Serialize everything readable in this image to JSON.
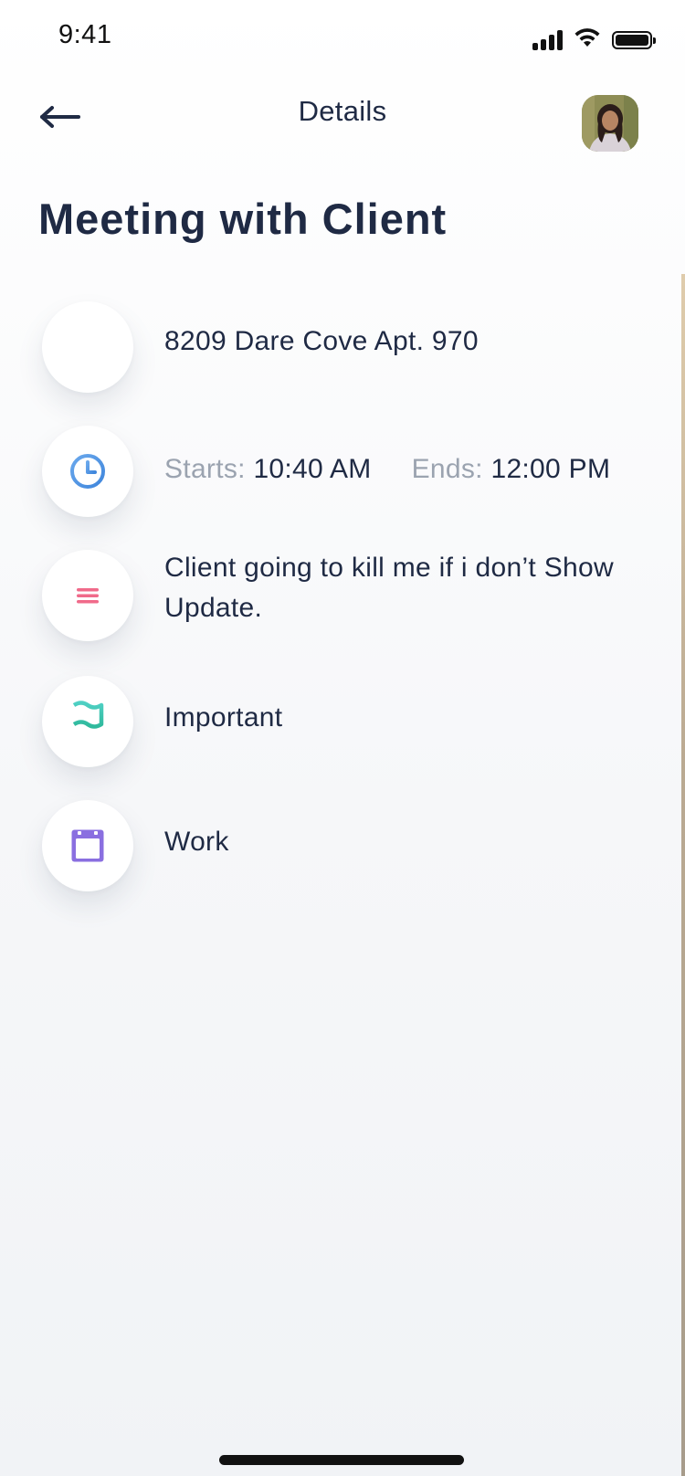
{
  "status_bar": {
    "time": "9:41"
  },
  "nav": {
    "title": "Details",
    "back_icon": "arrow-left-icon",
    "avatar_alt": "User avatar"
  },
  "event": {
    "title": "Meeting with Client",
    "location": "8209 Dare Cove Apt. 970",
    "starts_label": "Starts:",
    "starts_value": "10:40 AM",
    "ends_label": "Ends:",
    "ends_value": "12:00 PM",
    "description": "Client going to kill me if i don’t Show Update.",
    "priority": "Important",
    "category": "Work"
  },
  "icons": {
    "location": "location-icon",
    "time": "clock-icon",
    "description": "menu-lines-icon",
    "priority": "flag-icon",
    "category": "calendar-icon"
  },
  "colors": {
    "text_primary": "#1f2a44",
    "text_muted": "#9ba3b0",
    "clock_blue": "#4a90e2",
    "lines_pink": "#f06a8a",
    "flag_teal": "#3cc9b0",
    "calendar_purple": "#8a6fe0"
  }
}
